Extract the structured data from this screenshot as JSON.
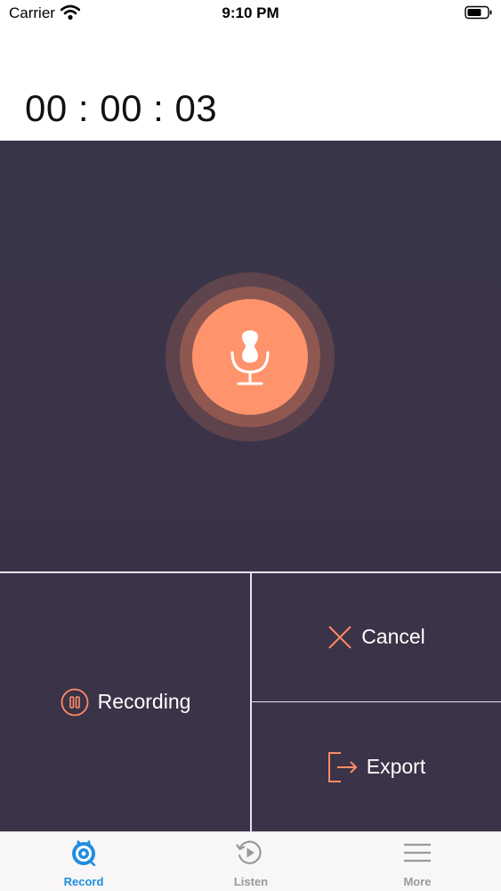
{
  "status_bar": {
    "carrier": "Carrier",
    "time": "9:10 PM"
  },
  "timer": {
    "elapsed": "00 : 00 : 03"
  },
  "controls": {
    "recording_label": "Recording",
    "cancel_label": "Cancel",
    "export_label": "Export"
  },
  "tab_bar": {
    "tabs": [
      {
        "label": "Record",
        "icon": "record-icon",
        "active": true
      },
      {
        "label": "Listen",
        "icon": "listen-icon",
        "active": false
      },
      {
        "label": "More",
        "icon": "menu-icon",
        "active": false
      }
    ]
  },
  "colors": {
    "accent": "#ff946c",
    "panel": "#3b3347",
    "tab_active": "#1f8ee0",
    "tab_inactive": "#9a9a9a"
  }
}
